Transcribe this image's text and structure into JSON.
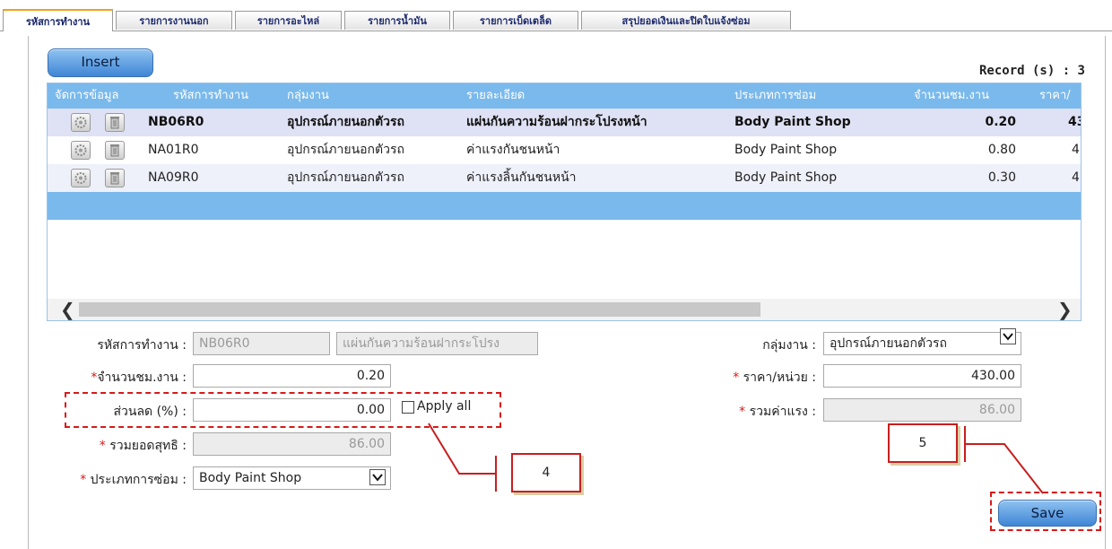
{
  "tabs": [
    {
      "label": "รหัสการทำงาน",
      "active": true
    },
    {
      "label": "รายการงานนอก",
      "active": false
    },
    {
      "label": "รายการอะไหล่",
      "active": false
    },
    {
      "label": "รายการน้ำมัน",
      "active": false
    },
    {
      "label": "รายการเบ็ดเตล็ด",
      "active": false
    },
    {
      "label": "สรุปยอดเงินและปิดใบแจ้งซ่อม",
      "active": false
    }
  ],
  "toolbar": {
    "insert_label": "Insert",
    "record_text": "Record (s) : 3"
  },
  "grid": {
    "columns": [
      "จัดการข้อมูล",
      "รหัสการทำงาน",
      "กลุ่มงาน",
      "รายละเอียด",
      "ประเภทการซ่อม",
      "จำนวนชม.งาน",
      "ราคา/"
    ],
    "rows": [
      {
        "code": "NB06R0",
        "group": "อุปกรณ์ภายนอกตัวรถ",
        "detail": "แผ่นกันความร้อนฝากระโปรงหน้า",
        "type": "Body Paint Shop",
        "hours": "0.20",
        "price": "43",
        "selected": true
      },
      {
        "code": "NA01R0",
        "group": "อุปกรณ์ภายนอกตัวรถ",
        "detail": "ค่าแรงกันชนหน้า",
        "type": "Body Paint Shop",
        "hours": "0.80",
        "price": "4",
        "selected": false
      },
      {
        "code": "NA09R0",
        "group": "อุปกรณ์ภายนอกตัวรถ",
        "detail": "ค่าแรงลิ้นกันชนหน้า",
        "type": "Body Paint Shop",
        "hours": "0.30",
        "price": "4",
        "selected": false
      }
    ],
    "scroll_left": "❮",
    "scroll_right": "❯"
  },
  "form": {
    "work_code_label": "รหัสการทำงาน :",
    "work_code_value": "NB06R0",
    "work_desc_value": "แผ่นกันความร้อนฝากระโปรง",
    "group_label": "กลุ่มงาน :",
    "group_value": "อุปกรณ์ภายนอกตัวรถ",
    "hours_label": "จำนวนชม.งาน :",
    "hours_value": "0.20",
    "unit_price_label": "ราคา/หน่วย :",
    "unit_price_value": "430.00",
    "discount_label": "ส่วนลด (%) :",
    "discount_value": "0.00",
    "apply_all_label": "Apply all",
    "labor_total_label": "รวมค่าแรง :",
    "labor_total_value": "86.00",
    "net_total_label": "รวมยอดสุทธิ :",
    "net_total_value": "86.00",
    "repair_type_label": "ประเภทการซ่อม :",
    "repair_type_value": "Body Paint Shop",
    "required_mark": "*"
  },
  "callouts": {
    "four": "4",
    "five": "5"
  },
  "actions": {
    "save_label": "Save"
  },
  "colors": {
    "header_blue": "#7ab9ec",
    "selected_row": "#dfe1f4",
    "alt_row": "#eef0fa",
    "annotation_red": "#d71a1a",
    "tab_accent": "#f2a01b"
  }
}
